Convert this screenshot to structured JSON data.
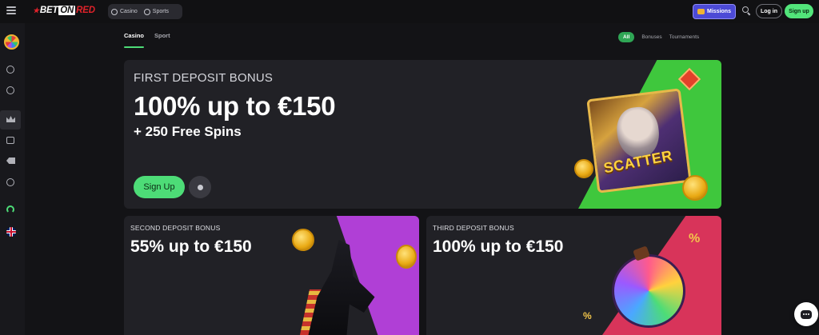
{
  "brand": {
    "part1": "BET",
    "part2": "ON",
    "part3": "RED"
  },
  "topnav": {
    "casino_label": "Casino",
    "sports_label": "Sports",
    "missions_label": "Missions",
    "login_label": "Log in",
    "signup_label": "Sign up"
  },
  "tabs": [
    {
      "label": "Casino",
      "active": true
    },
    {
      "label": "Sport",
      "active": false
    }
  ],
  "filters": [
    {
      "label": "All",
      "active": true
    },
    {
      "label": "Bonuses",
      "active": false
    },
    {
      "label": "Tournaments",
      "active": false
    }
  ],
  "hero": {
    "eyebrow": "FIRST DEPOSIT BONUS",
    "title": "100% up to €150",
    "subtitle": "+ 250 Free Spins",
    "button_label": "Sign Up",
    "art_label": "SCATTER"
  },
  "cards": [
    {
      "eyebrow": "SECOND DEPOSIT BONUS",
      "title": "55% up to €150"
    },
    {
      "eyebrow": "THIRD DEPOSIT BONUS",
      "title": "100% up to €150"
    }
  ],
  "colors": {
    "accent": "#4ddc77",
    "brand_red": "#e0222a",
    "missions": "#4c4ad6",
    "hero_wedge": "#3fc73d",
    "card2_wedge": "#b03fd6",
    "card3_wedge": "#d8345a"
  },
  "icons": {
    "sidebar": [
      "menu-icon",
      "wheel-icon",
      "casino-icon",
      "sports-ball-icon",
      "crown-icon",
      "trophy-icon",
      "tag-icon",
      "live-icon",
      "headset-icon",
      "uk-flag-icon"
    ],
    "chat": "chat-icon",
    "search": "search-icon"
  }
}
